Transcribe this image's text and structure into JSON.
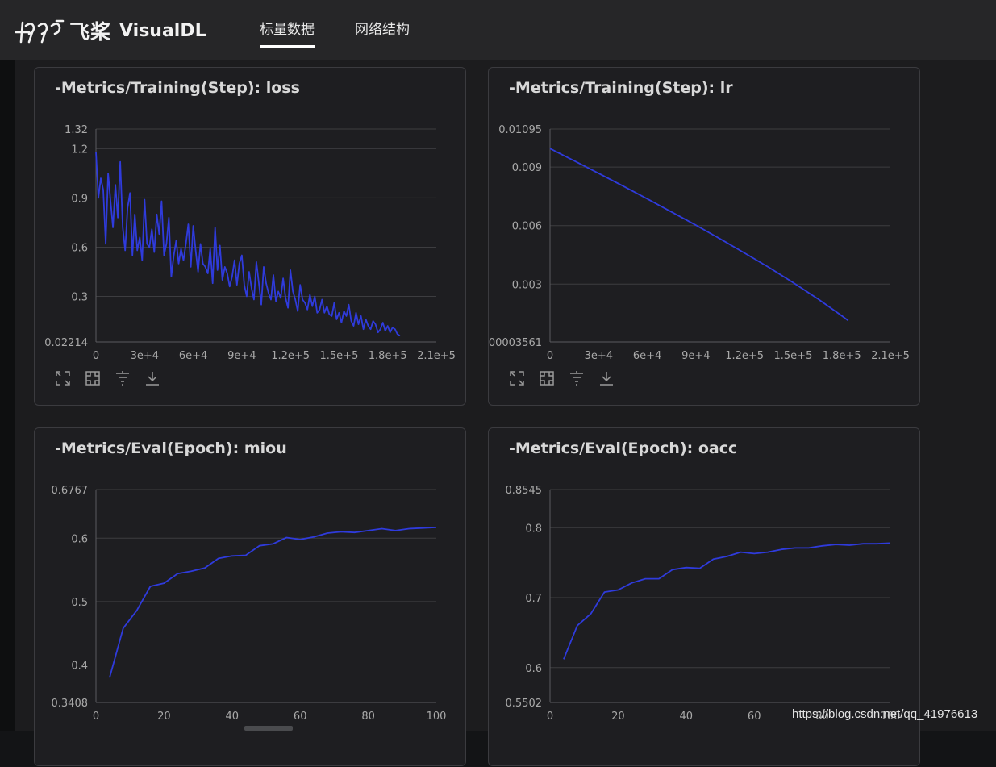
{
  "app": {
    "logo_cn": "飞桨",
    "logo_en": "VisualDL"
  },
  "nav": [
    {
      "label": "标量数据",
      "active": true
    },
    {
      "label": "网络结构",
      "active": false
    }
  ],
  "theme": {
    "line_color": "#2f3bdc",
    "axis_text": "#a9a9a9",
    "grid": "#3d3d40"
  },
  "charts": [
    {
      "title": "-Metrics/Training(Step): loss"
    },
    {
      "title": "-Metrics/Training(Step): lr"
    },
    {
      "title": "-Metrics/Eval(Epoch): miou"
    },
    {
      "title": "-Metrics/Eval(Epoch): oacc"
    }
  ],
  "chart_data": [
    {
      "type": "line",
      "title": "-Metrics/Training(Step): loss",
      "xlim": [
        0,
        210000
      ],
      "ylim": [
        0.02214,
        1.32
      ],
      "xticks": [
        "0",
        "3e+4",
        "6e+4",
        "9e+4",
        "1.2e+5",
        "1.5e+5",
        "1.8e+5",
        "2.1e+5"
      ],
      "xtick_values": [
        0,
        30000,
        60000,
        90000,
        120000,
        150000,
        180000,
        210000
      ],
      "yticks": [
        "0.02214",
        "0.3",
        "0.6",
        "0.9",
        "1.2",
        "1.32"
      ],
      "ytick_values": [
        0.02214,
        0.3,
        0.6,
        0.9,
        1.2,
        1.32
      ],
      "grid": true,
      "series": [
        {
          "x": [
            0,
            1500,
            3000,
            4500,
            6000,
            7500,
            9000,
            10500,
            12000,
            13500,
            15000,
            16500,
            18000,
            19500,
            21000,
            22500,
            24000,
            25500,
            27000,
            28500,
            30000,
            31500,
            33000,
            34500,
            36000,
            37500,
            39000,
            40500,
            42000,
            43500,
            45000,
            46500,
            48000,
            49500,
            51000,
            52500,
            54000,
            55500,
            57000,
            58500,
            60000,
            61500,
            63000,
            64500,
            66000,
            67500,
            69000,
            70500,
            72000,
            73500,
            75000,
            76500,
            78000,
            79500,
            81000,
            82500,
            84000,
            85500,
            87000,
            88500,
            90000,
            91500,
            93000,
            94500,
            96000,
            97500,
            99000,
            100500,
            102000,
            103500,
            105000,
            106500,
            108000,
            109500,
            111000,
            112500,
            114000,
            115500,
            117000,
            118500,
            120000,
            121500,
            123000,
            124500,
            126000,
            127500,
            129000,
            130500,
            132000,
            133500,
            135000,
            136500,
            138000,
            139500,
            141000,
            142500,
            144000,
            145500,
            147000,
            148500,
            150000,
            151500,
            153000,
            154500,
            156000,
            157500,
            159000,
            160500,
            162000,
            163500,
            165000,
            166500,
            168000,
            169500,
            171000,
            172500,
            174000,
            175500,
            177000,
            178500,
            180000,
            181500,
            183000,
            184500,
            186000,
            187500
          ],
          "y": [
            1.18,
            0.9,
            1.02,
            0.95,
            0.62,
            1.05,
            0.88,
            0.72,
            0.98,
            0.78,
            1.12,
            0.72,
            0.58,
            0.84,
            0.93,
            0.55,
            0.8,
            0.58,
            0.66,
            0.52,
            0.89,
            0.62,
            0.6,
            0.71,
            0.57,
            0.8,
            0.68,
            0.88,
            0.55,
            0.62,
            0.78,
            0.42,
            0.55,
            0.64,
            0.5,
            0.59,
            0.52,
            0.62,
            0.74,
            0.48,
            0.73,
            0.58,
            0.45,
            0.62,
            0.5,
            0.48,
            0.44,
            0.59,
            0.38,
            0.72,
            0.46,
            0.61,
            0.4,
            0.48,
            0.44,
            0.36,
            0.42,
            0.52,
            0.37,
            0.5,
            0.55,
            0.37,
            0.3,
            0.45,
            0.35,
            0.28,
            0.51,
            0.38,
            0.25,
            0.48,
            0.38,
            0.32,
            0.28,
            0.43,
            0.27,
            0.33,
            0.29,
            0.41,
            0.29,
            0.23,
            0.46,
            0.33,
            0.28,
            0.21,
            0.37,
            0.28,
            0.26,
            0.22,
            0.31,
            0.24,
            0.3,
            0.2,
            0.22,
            0.28,
            0.2,
            0.24,
            0.19,
            0.18,
            0.26,
            0.16,
            0.2,
            0.14,
            0.21,
            0.18,
            0.25,
            0.15,
            0.12,
            0.2,
            0.13,
            0.18,
            0.1,
            0.16,
            0.12,
            0.1,
            0.15,
            0.13,
            0.08,
            0.1,
            0.14,
            0.09,
            0.12,
            0.08,
            0.11,
            0.1,
            0.07,
            0.06
          ]
        }
      ]
    },
    {
      "type": "line",
      "title": "-Metrics/Training(Step): lr",
      "xlim": [
        0,
        210000
      ],
      "ylim": [
        3.561e-05,
        0.01095
      ],
      "xticks": [
        "0",
        "3e+4",
        "6e+4",
        "9e+4",
        "1.2e+5",
        "1.5e+5",
        "1.8e+5",
        "2.1e+5"
      ],
      "xtick_values": [
        0,
        30000,
        60000,
        90000,
        120000,
        150000,
        180000,
        210000
      ],
      "yticks": [
        "00003561",
        "0.003",
        "0.006",
        "0.009",
        "0.01095"
      ],
      "ytick_values": [
        3.561e-05,
        0.003,
        0.006,
        0.009,
        0.01095
      ],
      "grid": true,
      "series": [
        {
          "x": [
            0,
            15000,
            30000,
            45000,
            60000,
            75000,
            90000,
            105000,
            120000,
            135000,
            150000,
            165000,
            180000,
            184000
          ],
          "y": [
            0.00995,
            0.00932,
            0.00868,
            0.00803,
            0.00737,
            0.0067,
            0.00602,
            0.00532,
            0.0046,
            0.00386,
            0.00308,
            0.00226,
            0.00138,
            0.00113
          ]
        }
      ]
    },
    {
      "type": "line",
      "title": "-Metrics/Eval(Epoch): miou",
      "xlim": [
        0,
        100
      ],
      "ylim": [
        0.3408,
        0.6767
      ],
      "xticks": [
        "0",
        "20",
        "40",
        "60",
        "80",
        "100"
      ],
      "xtick_values": [
        0,
        20,
        40,
        60,
        80,
        100
      ],
      "yticks": [
        "0.3408",
        "0.4",
        "0.5",
        "0.6",
        "0.6767"
      ],
      "ytick_values": [
        0.3408,
        0.4,
        0.5,
        0.6,
        0.6767
      ],
      "grid": true,
      "series": [
        {
          "x": [
            4,
            8,
            12,
            16,
            20,
            24,
            28,
            32,
            36,
            40,
            44,
            48,
            52,
            56,
            60,
            64,
            68,
            72,
            76,
            80,
            84,
            88,
            92,
            96,
            100
          ],
          "y": [
            0.38,
            0.458,
            0.486,
            0.524,
            0.529,
            0.544,
            0.548,
            0.553,
            0.568,
            0.572,
            0.573,
            0.588,
            0.591,
            0.601,
            0.598,
            0.602,
            0.608,
            0.61,
            0.609,
            0.612,
            0.615,
            0.612,
            0.615,
            0.616,
            0.617
          ]
        }
      ]
    },
    {
      "type": "line",
      "title": "-Metrics/Eval(Epoch): oacc",
      "xlim": [
        0,
        100
      ],
      "ylim": [
        0.5502,
        0.8545
      ],
      "xticks": [
        "0",
        "20",
        "40",
        "60",
        "80",
        "100"
      ],
      "xtick_values": [
        0,
        20,
        40,
        60,
        80,
        100
      ],
      "yticks": [
        "0.5502",
        "0.6",
        "0.7",
        "0.8",
        "0.8545"
      ],
      "ytick_values": [
        0.5502,
        0.6,
        0.7,
        0.8,
        0.8545
      ],
      "grid": true,
      "series": [
        {
          "x": [
            4,
            8,
            12,
            16,
            20,
            24,
            28,
            32,
            36,
            40,
            44,
            48,
            52,
            56,
            60,
            64,
            68,
            72,
            76,
            80,
            84,
            88,
            92,
            96,
            100
          ],
          "y": [
            0.612,
            0.66,
            0.677,
            0.708,
            0.711,
            0.721,
            0.727,
            0.727,
            0.74,
            0.743,
            0.742,
            0.755,
            0.759,
            0.765,
            0.763,
            0.765,
            0.769,
            0.771,
            0.771,
            0.774,
            0.776,
            0.775,
            0.777,
            0.777,
            0.778
          ]
        }
      ]
    }
  ],
  "toolbar_icons": [
    "fullscreen-icon",
    "restore-zoom-icon",
    "filter-icon",
    "download-icon"
  ],
  "watermark": "https://blog.csdn.net/qq_41976613"
}
